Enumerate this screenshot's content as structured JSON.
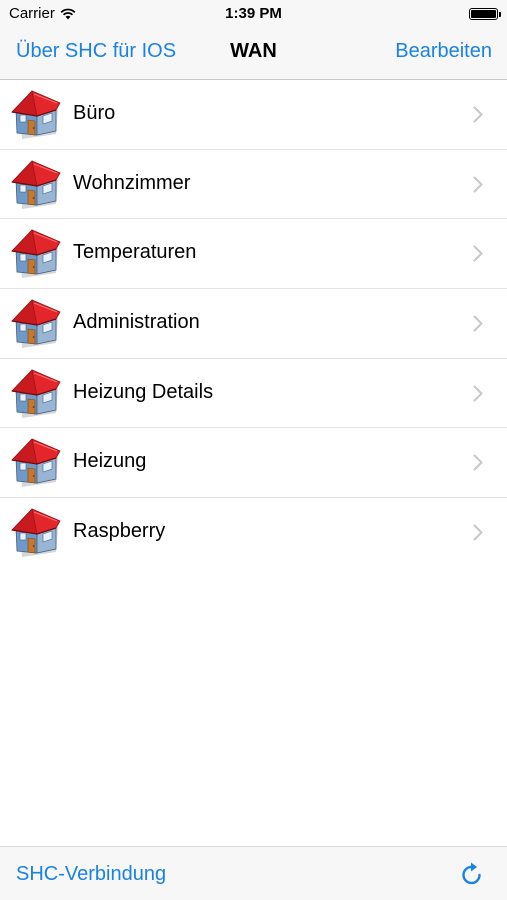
{
  "status_bar": {
    "carrier": "Carrier",
    "time": "1:39 PM",
    "icons": [
      "wifi-icon",
      "battery-icon"
    ]
  },
  "nav": {
    "left_label": "Über SHC für IOS",
    "title": "WAN",
    "right_label": "Bearbeiten"
  },
  "rows": [
    {
      "label": "Büro",
      "icon": "house-icon"
    },
    {
      "label": "Wohnzimmer",
      "icon": "house-icon"
    },
    {
      "label": "Temperaturen",
      "icon": "house-icon"
    },
    {
      "label": "Administration",
      "icon": "house-icon"
    },
    {
      "label": "Heizung Details",
      "icon": "house-icon"
    },
    {
      "label": "Heizung",
      "icon": "house-icon"
    },
    {
      "label": "Raspberry",
      "icon": "house-icon"
    }
  ],
  "toolbar": {
    "left_label": "SHC-Verbindung",
    "right_icon": "refresh-icon"
  },
  "colors": {
    "accent": "#1a82e2",
    "roof": "#e3262b",
    "wall": "#6f9ac7",
    "door": "#c8772c",
    "bar_bg": "#f7f7f7"
  }
}
